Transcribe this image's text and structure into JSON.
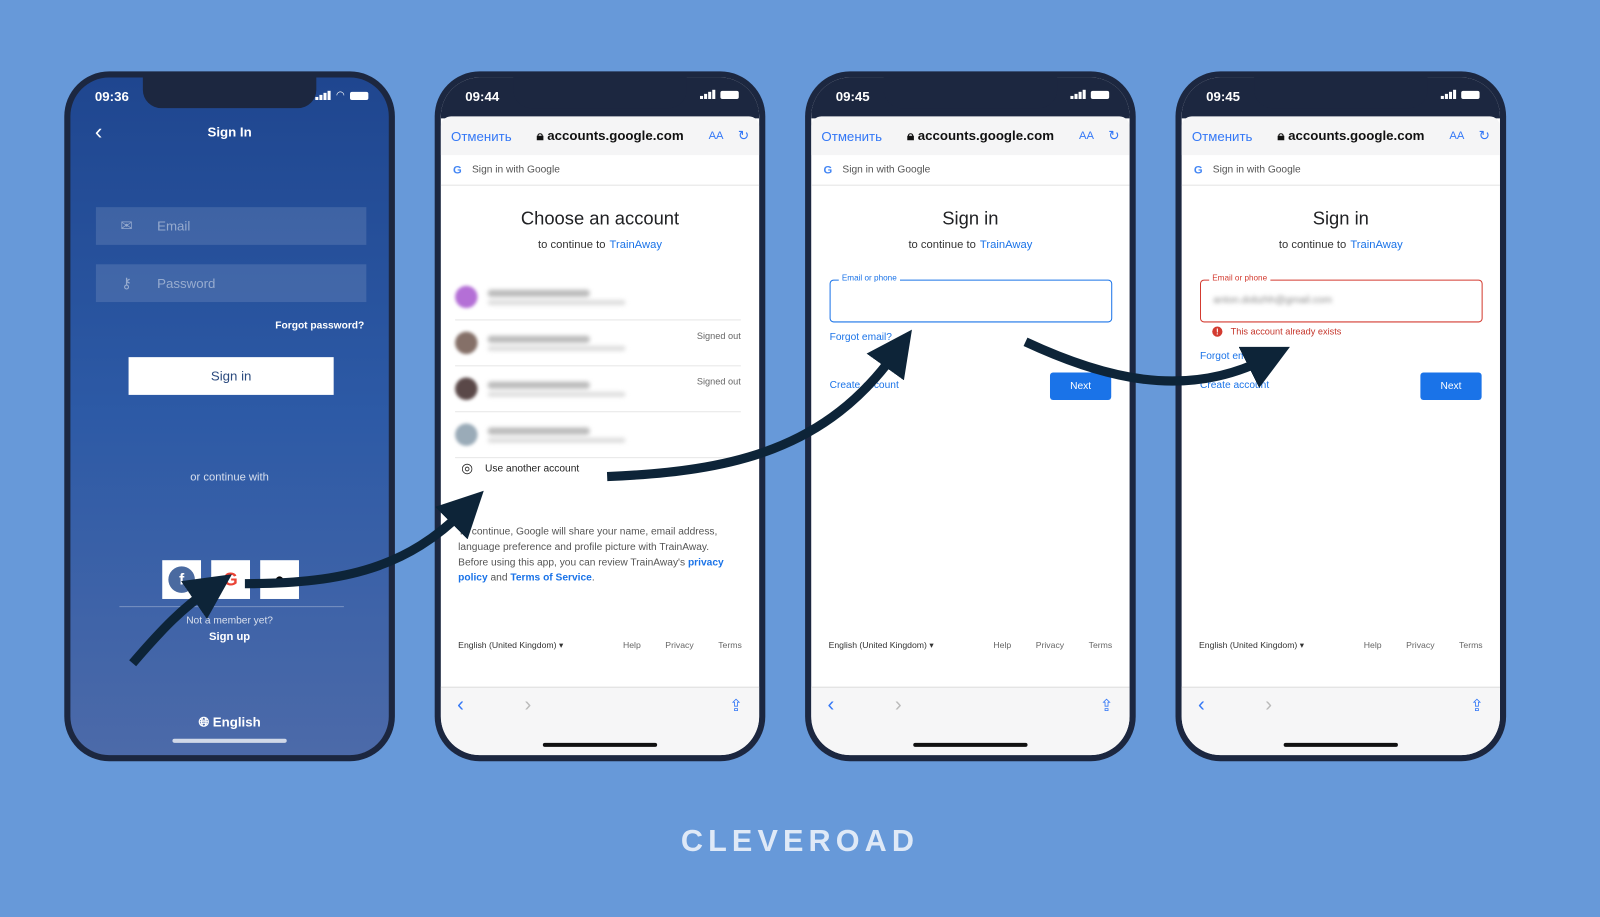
{
  "colors": {
    "background": "#6799d9",
    "frame": "#1c2740",
    "arrow": "#0d2438",
    "link": "#1a73e8",
    "error": "#d33b30"
  },
  "screen1": {
    "time": "09:36",
    "title": "Sign In",
    "email_placeholder": "Email",
    "password_placeholder": "Password",
    "forgot": "Forgot password?",
    "signin": "Sign in",
    "or_continue": "or continue with",
    "not_member": "Not a member yet?",
    "signup": "Sign up",
    "language": "English",
    "social_icons": [
      "facebook-icon",
      "google-icon",
      "apple-icon"
    ]
  },
  "browser": {
    "cancel": "Отменить",
    "url": "accounts.google.com",
    "aa": "AA",
    "google_bar": "Sign in with Google"
  },
  "screen2": {
    "time": "09:44",
    "title": "Choose an account",
    "subtitle": "to continue to",
    "app": "TrainAway",
    "accounts": [
      {
        "status": ""
      },
      {
        "status": "Signed out"
      },
      {
        "status": "Signed out"
      },
      {
        "status": ""
      }
    ],
    "use_another": "Use another account",
    "consent": "To continue, Google will share your name, email address, language preference and profile picture with TrainAway. Before using this app, you can review TrainAway's",
    "privacy_policy": "privacy policy",
    "and": "and",
    "terms_of_service": "Terms of Service"
  },
  "footer": {
    "language": "English (United Kingdom)",
    "help": "Help",
    "privacy": "Privacy",
    "terms": "Terms"
  },
  "screen3": {
    "time": "09:45",
    "title": "Sign in",
    "subtitle": "to continue to",
    "app": "TrainAway",
    "field_label": "Email or phone",
    "forgot_email": "Forgot email?",
    "create_account": "Create account",
    "next": "Next"
  },
  "screen4": {
    "time": "09:45",
    "title": "Sign in",
    "subtitle": "to continue to",
    "app": "TrainAway",
    "field_label": "Email or phone",
    "field_value": "anton.dobzhh@gmail.com",
    "error": "This account already exists",
    "forgot_email": "Forgot email?",
    "create_account": "Create account",
    "next": "Next"
  },
  "brand": "CLEVEROAD"
}
